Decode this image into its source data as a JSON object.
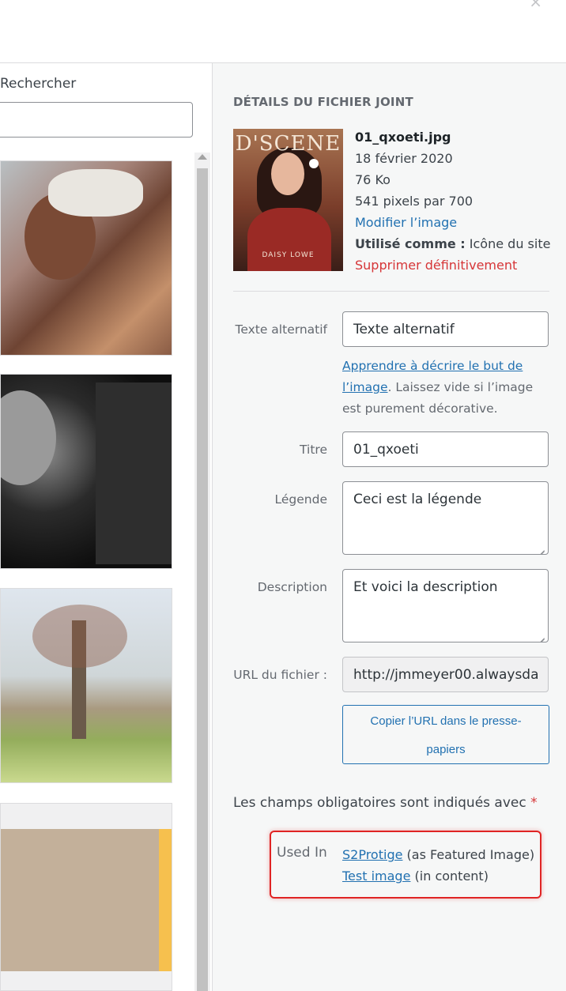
{
  "search": {
    "label": "Rechercher",
    "value": ""
  },
  "details": {
    "title": "DÉTAILS DU FICHIER JOINT",
    "preview": {
      "magazine": "D'SCENE",
      "cover_name": "DAISY LOWE"
    },
    "filename": "01_qxoeti.jpg",
    "date": "18 février 2020",
    "size": "76 Ko",
    "dimensions": "541 pixels par 700",
    "edit_link": "Modifier l’image",
    "used_as_label": "Utilisé comme :",
    "used_as_value": "Icône du site",
    "delete_link": "Supprimer définitivement"
  },
  "fields": {
    "alt": {
      "label": "Texte alternatif",
      "value": "Texte alternatif"
    },
    "alt_help": {
      "link": "Apprendre à décrire le but de l’image",
      "text": ". Laissez vide si l’image est purement décorative."
    },
    "title": {
      "label": "Titre",
      "value": "01_qxoeti"
    },
    "caption": {
      "label": "Légende",
      "value": "Ceci est la légende"
    },
    "description": {
      "label": "Description",
      "value": "Et voici la description"
    },
    "url": {
      "label": "URL du fichier :",
      "value": "http://jmmeyer00.alwaysda"
    },
    "copy_button": "Copier l’URL dans le presse-papiers"
  },
  "required_note": {
    "text": "Les champs obligatoires sont indiqués avec",
    "star": "*"
  },
  "used_in": {
    "label": "Used In",
    "items": [
      {
        "link": "S2Protige",
        "note": "(as Featured Image)"
      },
      {
        "link": "Test image",
        "note": "(in content)"
      }
    ]
  }
}
